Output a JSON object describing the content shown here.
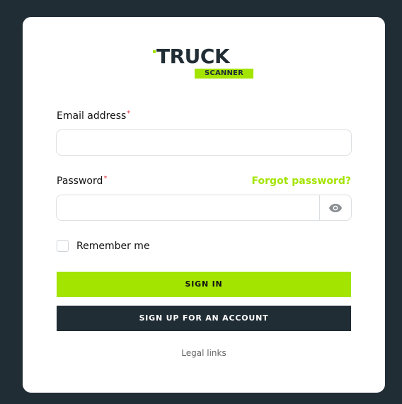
{
  "logo": {
    "line1": "TRUCK",
    "line2": "SCANNER"
  },
  "form": {
    "email": {
      "label": "Email address",
      "required_mark": "*",
      "value": "",
      "placeholder": ""
    },
    "password": {
      "label": "Password",
      "required_mark": "*",
      "value": "",
      "placeholder": "",
      "toggle_icon": "eye-icon"
    },
    "forgot_password": "Forgot password?",
    "remember_me": {
      "label": "Remember me",
      "checked": false
    },
    "sign_in_label": "SIGN IN",
    "sign_up_label": "SIGN UP FOR AN ACCOUNT"
  },
  "footer": {
    "legal_links": "Legal links"
  },
  "colors": {
    "background": "#212d35",
    "card": "#ffffff",
    "accent": "#a3e400",
    "dark_button": "#212d35",
    "required": "#e0303a"
  }
}
